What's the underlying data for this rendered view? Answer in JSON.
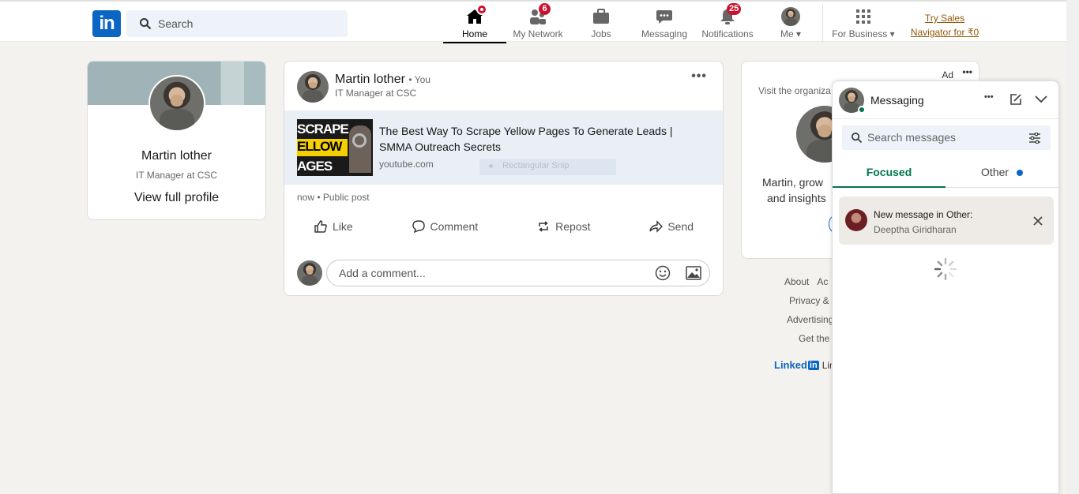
{
  "header": {
    "logo_text": "in",
    "search_placeholder": "Search",
    "nav": [
      {
        "label": "Home",
        "badge": ""
      },
      {
        "label": "My Network",
        "badge": "6"
      },
      {
        "label": "Jobs",
        "badge": ""
      },
      {
        "label": "Messaging",
        "badge": ""
      },
      {
        "label": "Notifications",
        "badge": "25"
      },
      {
        "label": "Me",
        "badge": ""
      }
    ],
    "for_business": "For Business",
    "premium_line1": "Try Sales",
    "premium_line2": "Navigator for ₹0"
  },
  "profile": {
    "name": "Martin lother",
    "headline": "IT Manager at CSC",
    "view_profile": "View full profile"
  },
  "post": {
    "author": "Martin lother",
    "you": "• You",
    "headline": "IT Manager at CSC",
    "link_title": "The Best Way To Scrape Yellow Pages To Generate Leads | SMMA Outreach Secrets",
    "link_domain": "youtube.com",
    "thumb_line1": "SCRAPE",
    "thumb_line2": "ELLOW",
    "thumb_line3": "AGES",
    "overlay_text": "Rectangular Snip",
    "meta": "now • Public post",
    "actions": {
      "like": "Like",
      "comment": "Comment",
      "repost": "Repost",
      "send": "Send"
    },
    "comment_placeholder": "Add a comment..."
  },
  "ad": {
    "label": "Ad",
    "visit": "Visit the organiza",
    "text_line1": "Martin, grow",
    "text_line2": "and insights"
  },
  "footer": {
    "about": "About",
    "ac": "Ac",
    "privacy": "Privacy &",
    "advertising": "Advertising",
    "get_the": "Get the",
    "brand": "Linked",
    "brand_tail": "Lin"
  },
  "messaging": {
    "title": "Messaging",
    "search_placeholder": "Search messages",
    "tab_focused": "Focused",
    "tab_other": "Other",
    "notice_title": "New message in Other:",
    "notice_sender": "Deeptha Giridharan"
  },
  "colors": {
    "brand": "#0a66c2",
    "badge": "#cb112d",
    "focused_tab": "#01754f",
    "premium": "#915907"
  }
}
